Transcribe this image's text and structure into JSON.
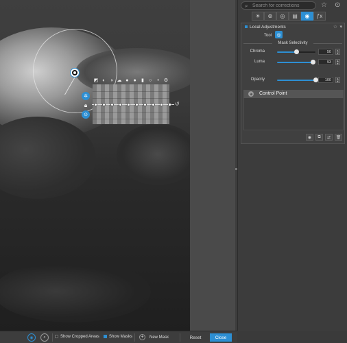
{
  "search": {
    "placeholder": "Search for corrections"
  },
  "tabs": [
    {
      "icon": "sun-icon",
      "glyph": "☀"
    },
    {
      "icon": "color-circles-icon",
      "glyph": "⊛"
    },
    {
      "icon": "detail-icon",
      "glyph": "◎"
    },
    {
      "icon": "film-icon",
      "glyph": "▤"
    },
    {
      "icon": "local-adjustments-icon",
      "glyph": "◉",
      "active": true
    },
    {
      "icon": "fx-icon",
      "glyph": "ƒx"
    }
  ],
  "local_adjustments": {
    "title": "Local Adjustments",
    "tool_label": "Tool",
    "mask_selectivity_label": "Mask Selectivity",
    "sliders": [
      {
        "label": "Chroma",
        "value": "50",
        "fraction": 0.5
      },
      {
        "label": "Luma",
        "value": "93",
        "fraction": 0.93
      }
    ],
    "opacity": {
      "label": "Opacity",
      "value": "100",
      "fraction": 1.0
    },
    "control_point_label": "Control Point"
  },
  "bottom_bar": {
    "show_cropped_areas": "Show Cropped Areas",
    "show_masks": "Show Masks",
    "new_mask": "New Mask",
    "reset": "Reset",
    "close": "Close"
  },
  "colors": {
    "accent": "#2d8fd3",
    "panel": "#3c3c3c",
    "background": "#3a3a3a"
  }
}
